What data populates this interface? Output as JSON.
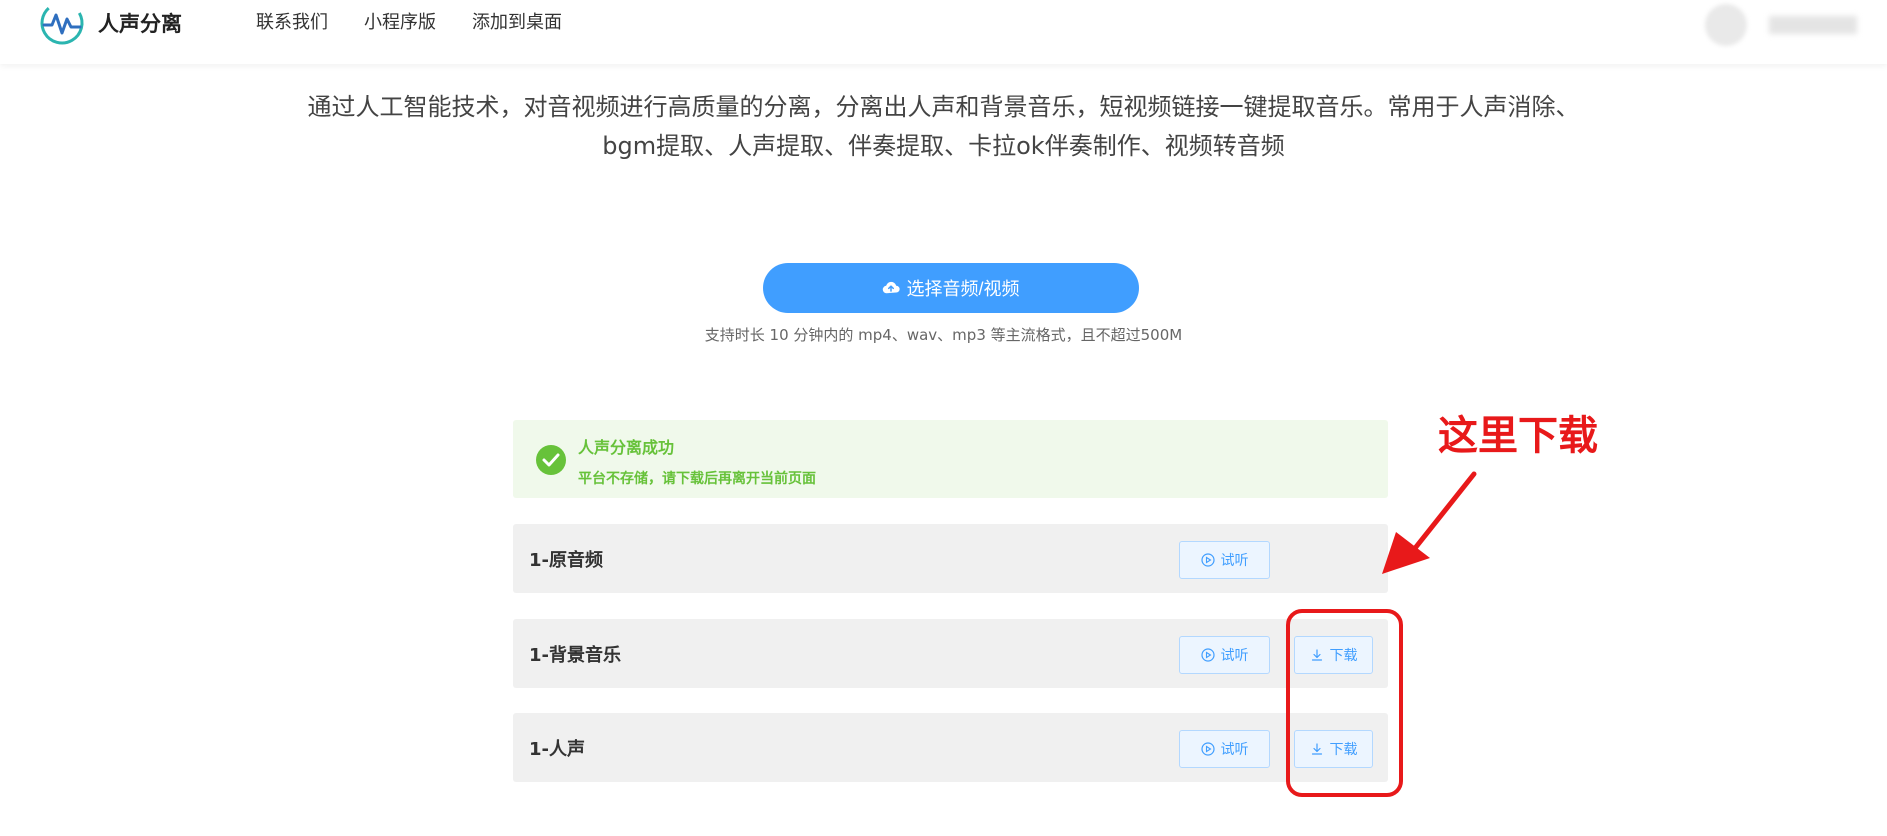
{
  "brand": {
    "name": "人声分离",
    "accent": "#409eff",
    "success": "#67c23a",
    "annotation": "#e8191a"
  },
  "nav": {
    "items": [
      "联系我们",
      "小程序版",
      "添加到桌面"
    ]
  },
  "description": {
    "line1": "通过人工智能技术，对音视频进行高质量的分离，分离出人声和背景音乐，短视频链接一键提取音乐。常用于人声消除、",
    "line2": "bgm提取、人声提取、伴奏提取、卡拉ok伴奏制作、视频转音频"
  },
  "upload": {
    "label": "选择音频/视频",
    "icon": "cloud-upload-icon",
    "hint": "支持时长 10 分钟内的 mp4、wav、mp3 等主流格式，且不超过500M"
  },
  "alert": {
    "title": "人声分离成功",
    "subtitle": "平台不存储，请下载后再离开当前页面",
    "icon": "check-circle-icon"
  },
  "results": [
    {
      "name": "1-原音频",
      "listen_label": "试听"
    },
    {
      "name": "1-背景音乐",
      "listen_label": "试听",
      "download_label": "下载"
    },
    {
      "name": "1-人声",
      "listen_label": "试听",
      "download_label": "下载"
    }
  ],
  "annotation": {
    "text": "这里下载"
  }
}
